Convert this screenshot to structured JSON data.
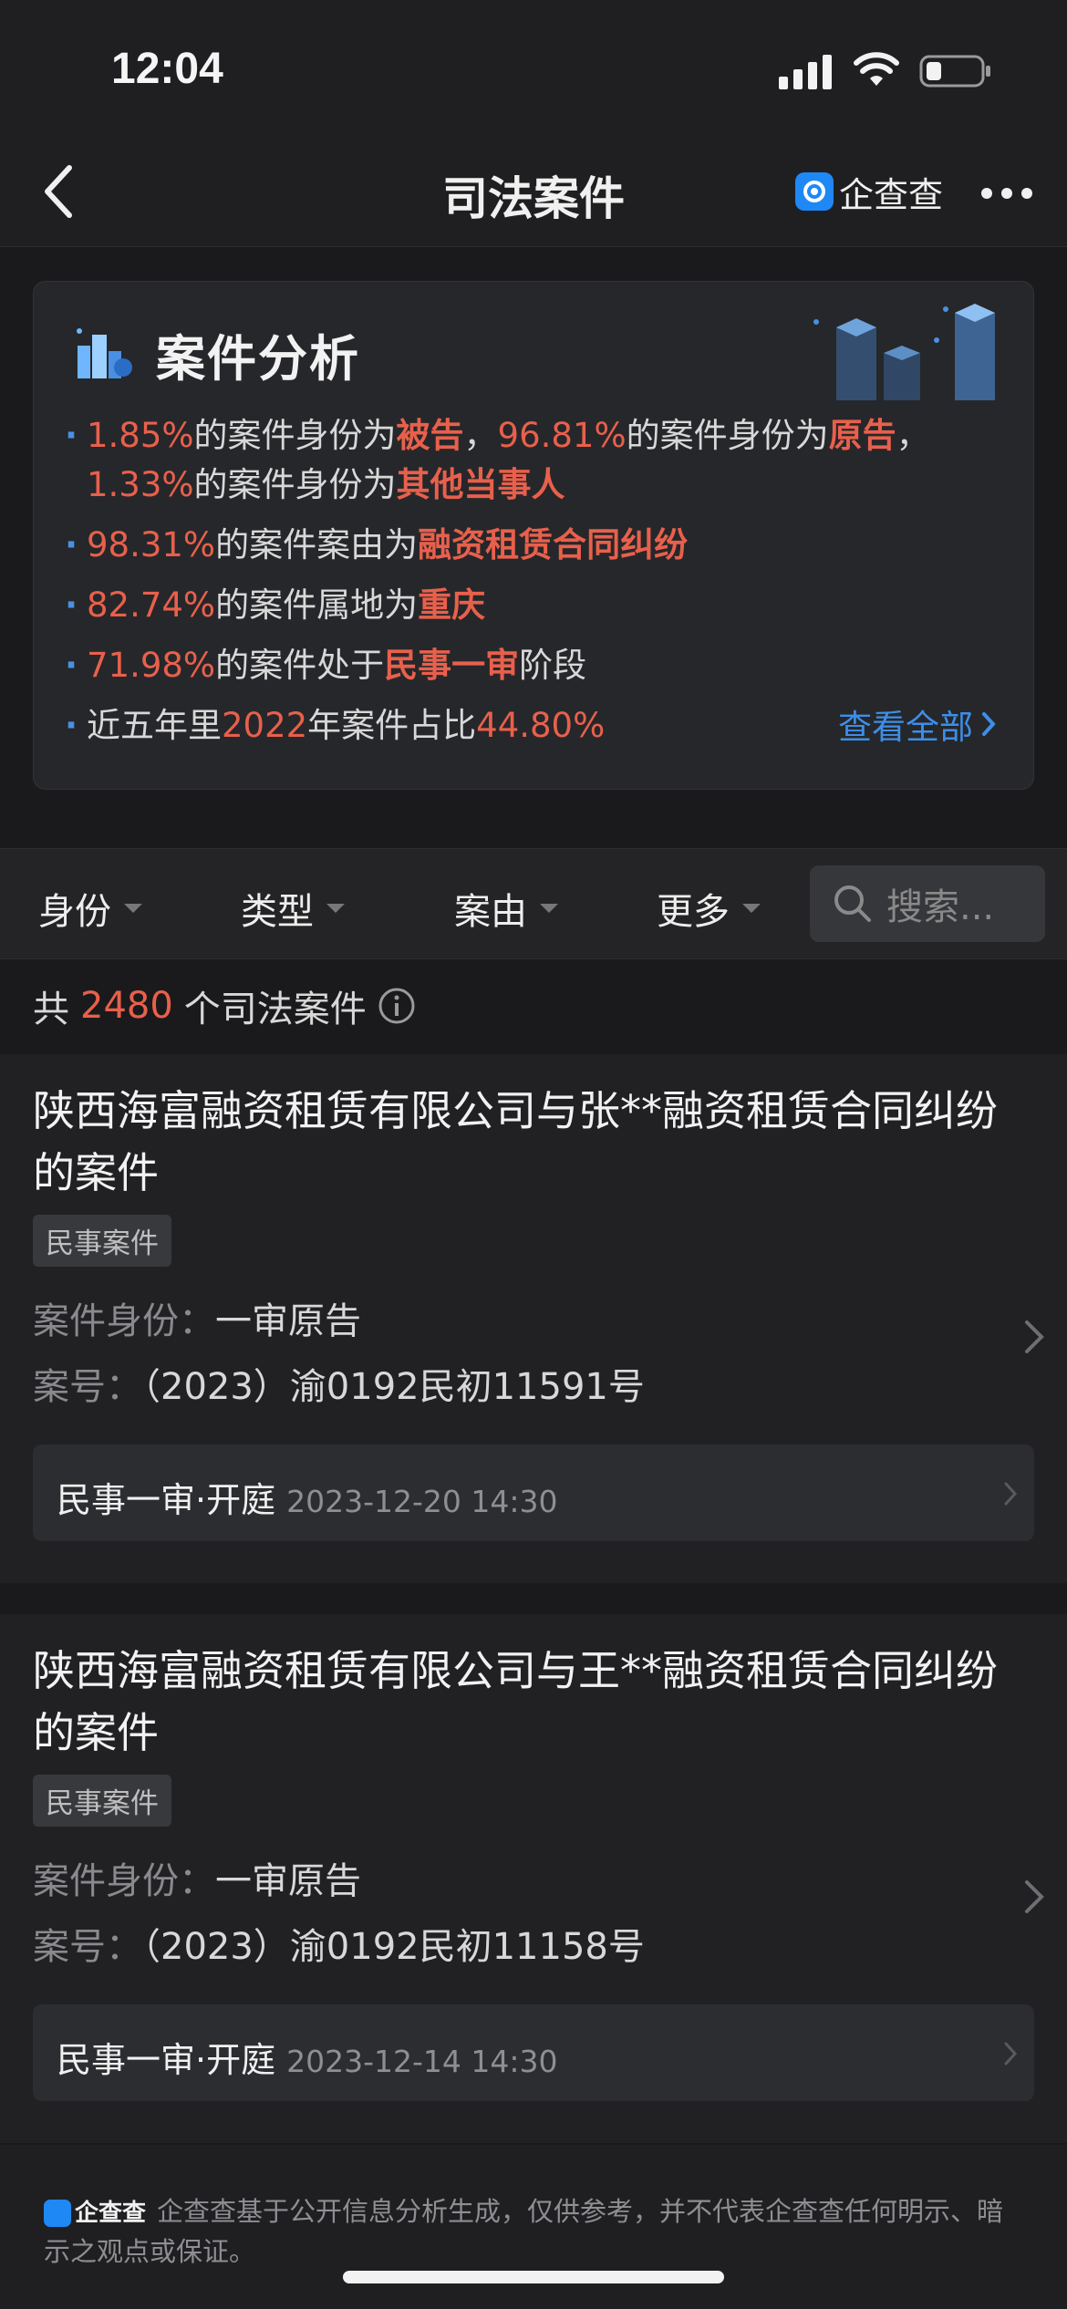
{
  "status": {
    "time": "12:04"
  },
  "nav": {
    "title": "司法案件",
    "brand": "企查查"
  },
  "analysis": {
    "title": "案件分析",
    "line1": {
      "p1": "1.85%",
      "t1": "的案件身份为",
      "k1": "被告",
      "sep1": "，",
      "p2": "96.81%",
      "t2": "的案件身份为",
      "k2": "原告",
      "sep2": "，",
      "p3": "1.33%",
      "t3": "的案件身份为",
      "k3": "其他当事人"
    },
    "line2": {
      "p": "98.31%",
      "t": "的案件案由为",
      "k": "融资租赁合同纠纷"
    },
    "line3": {
      "p": "82.74%",
      "t": "的案件属地为",
      "k": "重庆"
    },
    "line4": {
      "p": "71.98%",
      "t": "的案件处于",
      "k": "民事一审",
      "t2": "阶段"
    },
    "line5": {
      "t1": "近五年里",
      "year": "2022",
      "t2": "年案件占比",
      "p": "44.80%"
    },
    "view_all": "查看全部"
  },
  "filters": {
    "identity": "身份",
    "type": "类型",
    "cause": "案由",
    "more": "更多",
    "search_placeholder": "搜索..."
  },
  "count": {
    "prefix": "共",
    "number": "2480",
    "suffix": "个司法案件"
  },
  "cases": [
    {
      "title": "陕西海富融资租赁有限公司与张**融资租赁合同纠纷的案件",
      "tag": "民事案件",
      "role_label": "案件身份：",
      "role_value": "一审原告",
      "no_label": "案号：",
      "no_value": "（2023）渝0192民初11591号",
      "session_stage": "民事一审·开庭",
      "session_date": "2023-12-20 14:30"
    },
    {
      "title": "陕西海富融资租赁有限公司与王**融资租赁合同纠纷的案件",
      "tag": "民事案件",
      "role_label": "案件身份：",
      "role_value": "一审原告",
      "no_label": "案号：",
      "no_value": "（2023）渝0192民初11158号",
      "session_stage": "民事一审·开庭",
      "session_date": "2023-12-14 14:30"
    }
  ],
  "footer": {
    "logo_text": "企查查",
    "text": "企查查基于公开信息分析生成，仅供参考，并不代表企查查任何明示、暗示之观点或保证。"
  }
}
